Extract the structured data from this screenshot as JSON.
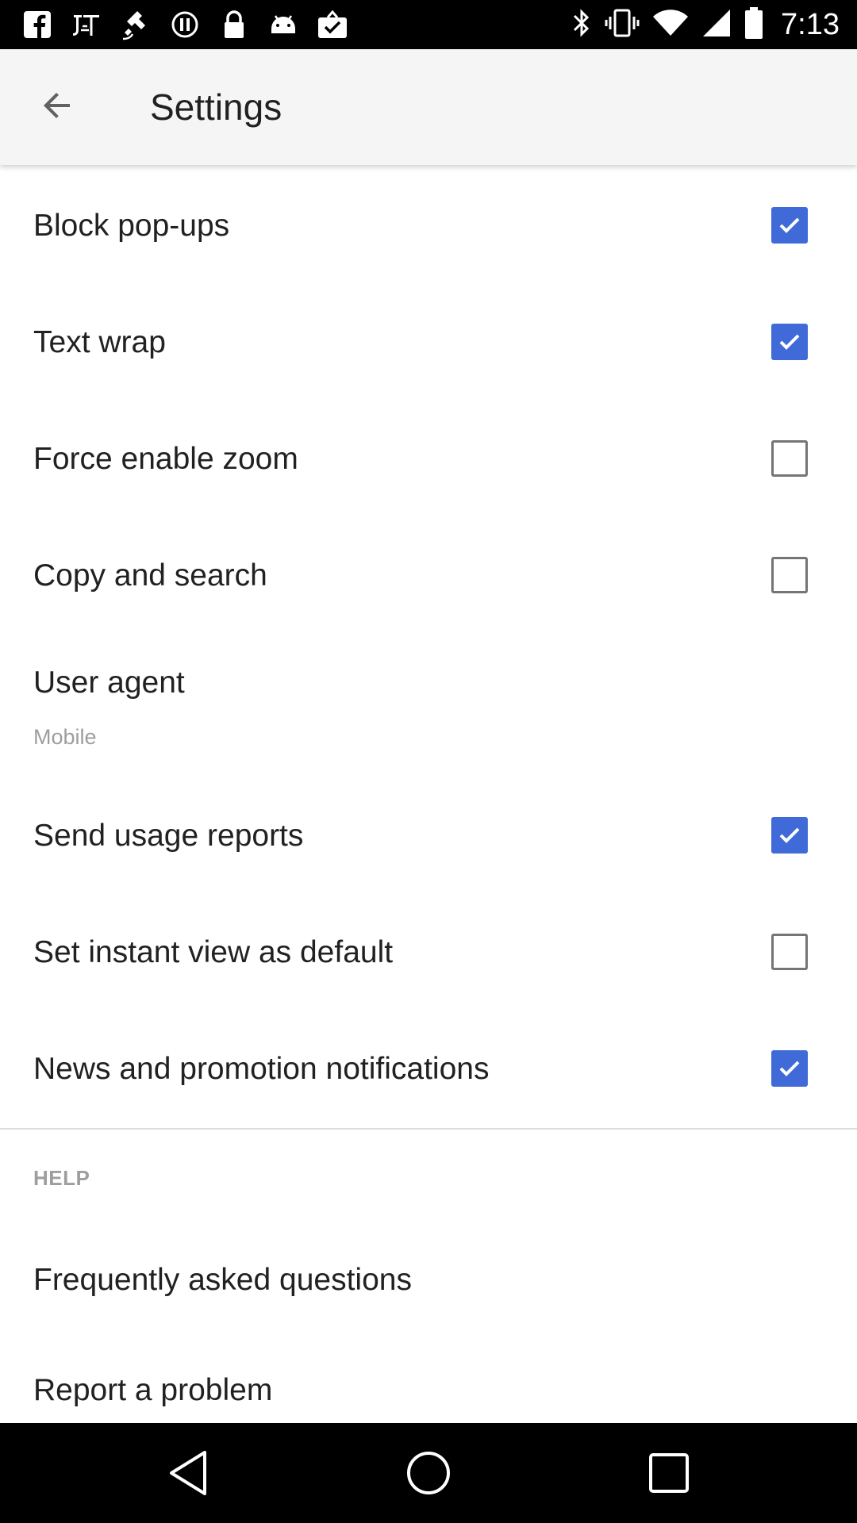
{
  "status_bar": {
    "time": "7:13",
    "left_icons": [
      "facebook-icon",
      "jio-tv-icon",
      "fake-gps-icon",
      "sync-icon",
      "lock-icon",
      "android-icon",
      "clipboard-check-icon"
    ],
    "right_icons": [
      "bluetooth-icon",
      "vibrate-icon",
      "wifi-icon",
      "signal-icon",
      "battery-icon"
    ]
  },
  "app_bar": {
    "title": "Settings",
    "back_icon": "arrow-back-icon"
  },
  "settings": [
    {
      "label": "Block pop-ups",
      "checked": true
    },
    {
      "label": "Text wrap",
      "checked": true
    },
    {
      "label": "Force enable zoom",
      "checked": false
    },
    {
      "label": "Copy and search",
      "checked": false
    },
    {
      "label": "User agent",
      "sublabel": "Mobile"
    },
    {
      "label": "Send usage reports",
      "checked": true
    },
    {
      "label": "Set instant view as default",
      "checked": false
    },
    {
      "label": "News and promotion notifications",
      "checked": true
    }
  ],
  "help_section": {
    "header": "HELP",
    "items": [
      {
        "label": "Frequently asked questions"
      },
      {
        "label": "Report a problem"
      }
    ]
  },
  "nav_bar": {
    "icons": [
      "back-triangle-icon",
      "home-circle-icon",
      "recents-square-icon"
    ]
  },
  "colors": {
    "accent": "#3f6ad8",
    "app_bar_bg": "#f5f5f5",
    "secondary_text": "#9e9e9e"
  }
}
